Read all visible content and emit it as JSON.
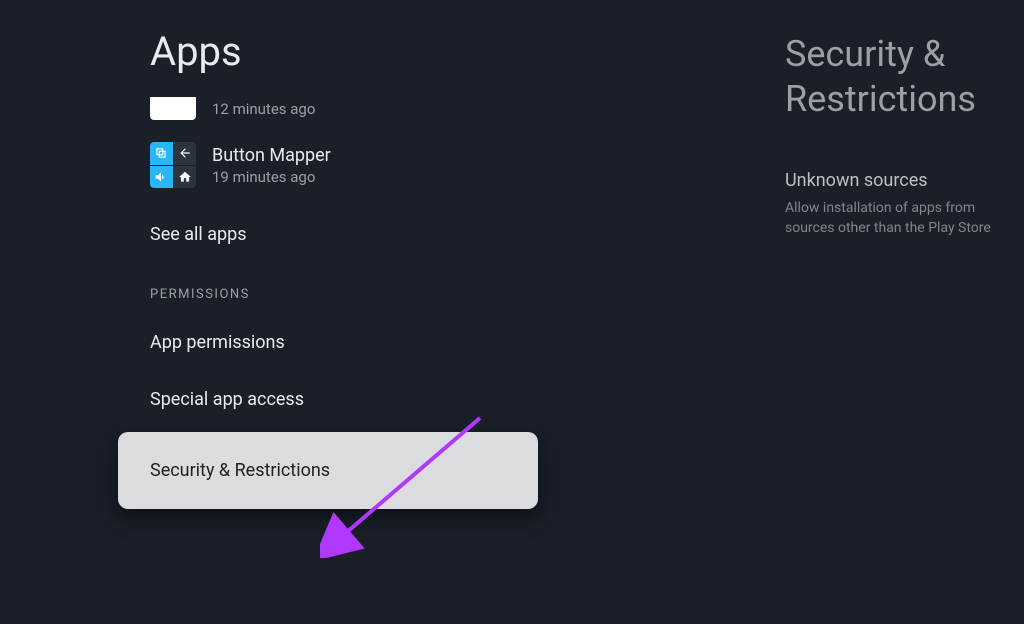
{
  "left": {
    "title": "Apps",
    "apps": [
      {
        "time": "12 minutes ago"
      },
      {
        "name": "Button Mapper",
        "time": "19 minutes ago"
      }
    ],
    "see_all": "See all apps",
    "section_permissions": "PERMISSIONS",
    "app_permissions": "App permissions",
    "special_access": "Special app access",
    "security_restrictions": "Security & Restrictions"
  },
  "right": {
    "title": "Security & Restrictions",
    "unknown_title": "Unknown sources",
    "unknown_desc": "Allow installation of apps from sources other than the Play Store"
  }
}
